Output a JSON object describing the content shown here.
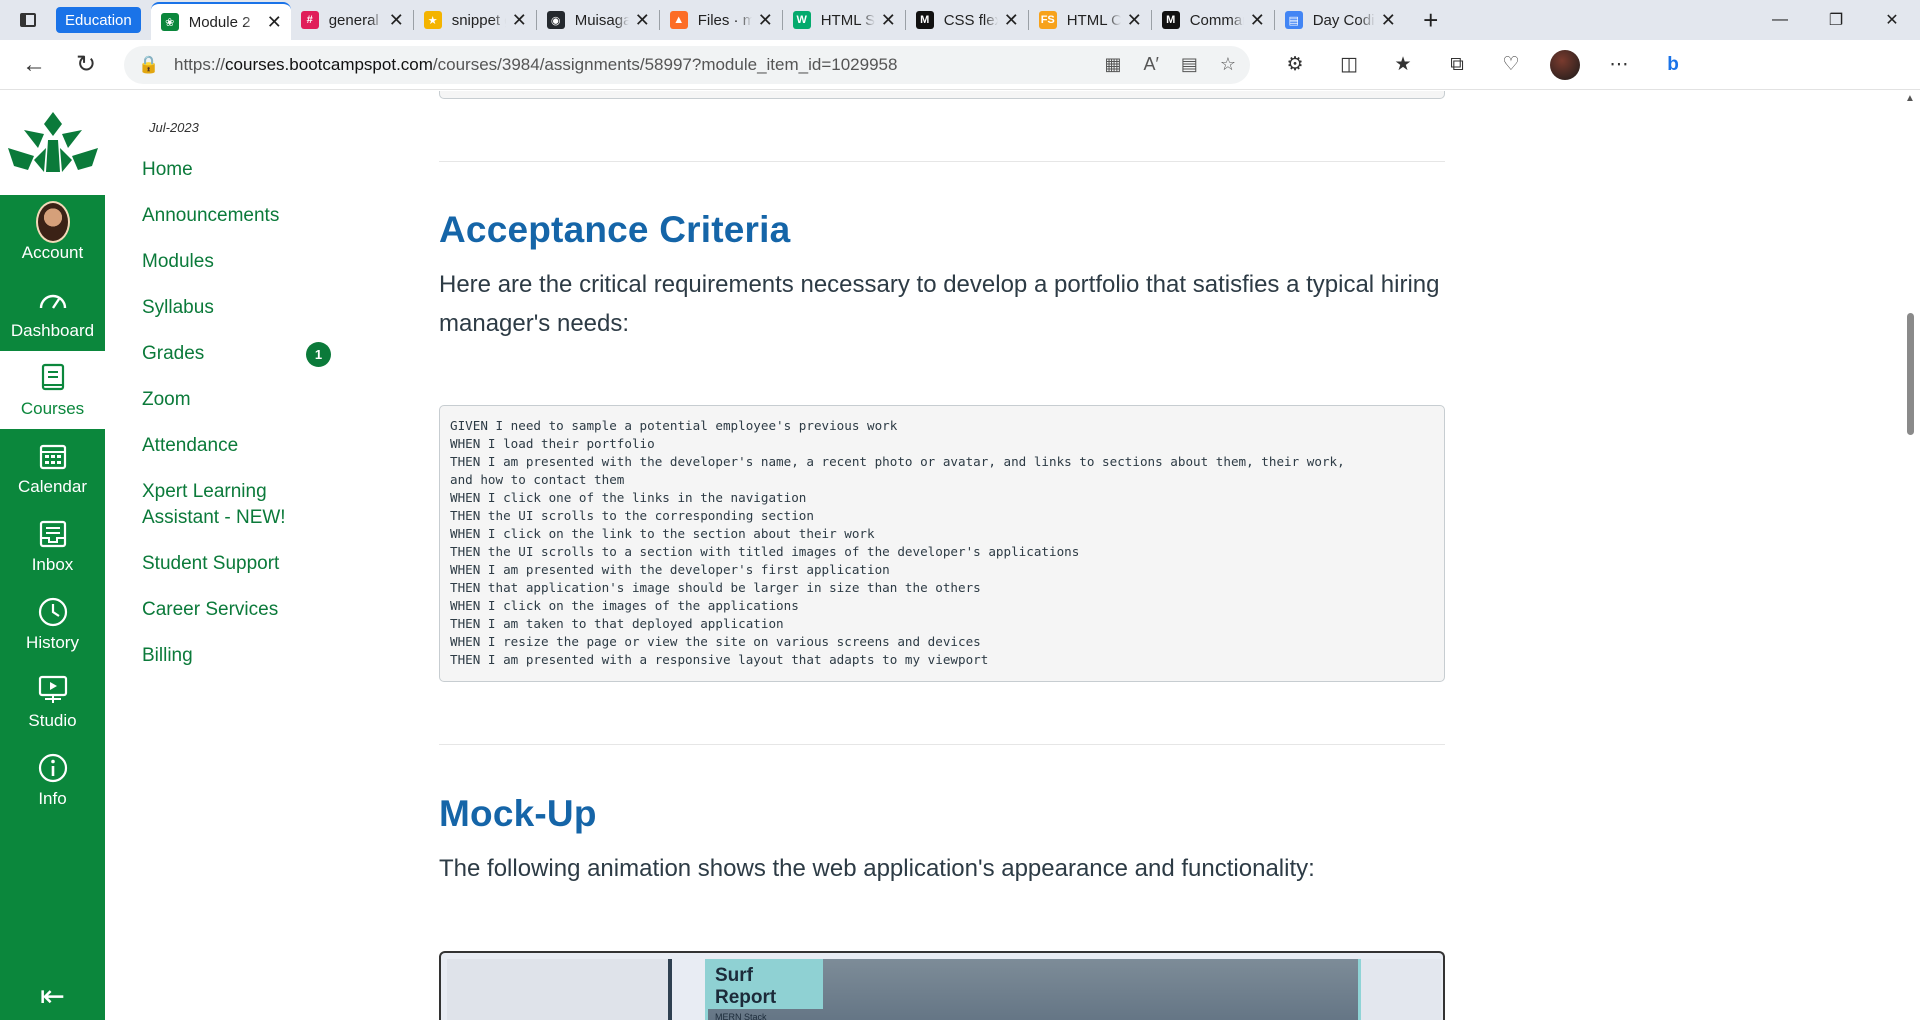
{
  "browser": {
    "tab_group_label": "Education",
    "tabs": [
      {
        "title": "Module 2",
        "active": true,
        "icon": "canvas-icon",
        "color": "#0b873c"
      },
      {
        "title": "general - U",
        "icon": "slack-icon",
        "color": "#e01e5a"
      },
      {
        "title": "snippet ge",
        "icon": "star-favicon-icon",
        "color": "#f4b400"
      },
      {
        "title": "Muisagara",
        "icon": "github-icon",
        "color": "#24292e"
      },
      {
        "title": "Files · mai",
        "icon": "gitlab-icon",
        "color": "#fc6d26"
      },
      {
        "title": "HTML Sem",
        "icon": "w3-icon",
        "color": "#04aa6d"
      },
      {
        "title": "CSS flexibl",
        "icon": "m-icon",
        "color": "#111111"
      },
      {
        "title": "HTML Che",
        "icon": "fs-icon",
        "color": "#f7a21b"
      },
      {
        "title": "Command",
        "icon": "m-icon",
        "color": "#111111"
      },
      {
        "title": "Day Codin",
        "icon": "docs-icon",
        "color": "#4285f4"
      }
    ],
    "url_prefix": "https://",
    "url_host": "courses.bootcampspot.com",
    "url_path": "/courses/3984/assignments/58997?module_item_id=1029958"
  },
  "global_nav": {
    "items": [
      {
        "label": "Account",
        "icon": "avatar-icon"
      },
      {
        "label": "Dashboard",
        "icon": "dashboard-icon"
      },
      {
        "label": "Courses",
        "icon": "courses-icon",
        "active": true
      },
      {
        "label": "Calendar",
        "icon": "calendar-icon"
      },
      {
        "label": "Inbox",
        "icon": "inbox-icon"
      },
      {
        "label": "History",
        "icon": "history-icon"
      },
      {
        "label": "Studio",
        "icon": "studio-icon"
      },
      {
        "label": "Info",
        "icon": "info-icon"
      }
    ],
    "accent_color": "#0b873c"
  },
  "course_nav": {
    "term": "Jul-2023",
    "items": [
      {
        "label": "Home"
      },
      {
        "label": "Announcements"
      },
      {
        "label": "Modules"
      },
      {
        "label": "Syllabus"
      },
      {
        "label": "Grades",
        "badge": "1"
      },
      {
        "label": "Zoom"
      },
      {
        "label": "Attendance"
      },
      {
        "label": "Xpert Learning Assistant - NEW!"
      },
      {
        "label": "Student Support"
      },
      {
        "label": "Career Services"
      },
      {
        "label": "Billing"
      }
    ]
  },
  "content": {
    "acceptance_heading": "Acceptance Criteria",
    "acceptance_intro": "Here are the critical requirements necessary to develop a portfolio that satisfies a typical hiring manager's needs:",
    "criteria_code": "GIVEN I need to sample a potential employee's previous work\nWHEN I load their portfolio\nTHEN I am presented with the developer's name, a recent photo or avatar, and links to sections about them, their work,\nand how to contact them\nWHEN I click one of the links in the navigation\nTHEN the UI scrolls to the corresponding section\nWHEN I click on the link to the section about their work\nTHEN the UI scrolls to a section with titled images of the developer's applications\nWHEN I am presented with the developer's first application\nTHEN that application's image should be larger in size than the others\nWHEN I click on the images of the applications\nTHEN I am taken to that deployed application\nWHEN I resize the page or view the site on various screens and devices\nTHEN I am presented with a responsive layout that adapts to my viewport",
    "mockup_heading": "Mock-Up",
    "mockup_intro": "The following animation shows the web application's appearance and functionality:",
    "mockup_image": {
      "title": "Surf Report",
      "subtitle": "MERN Stack"
    },
    "heading_color": "#1565a8"
  }
}
